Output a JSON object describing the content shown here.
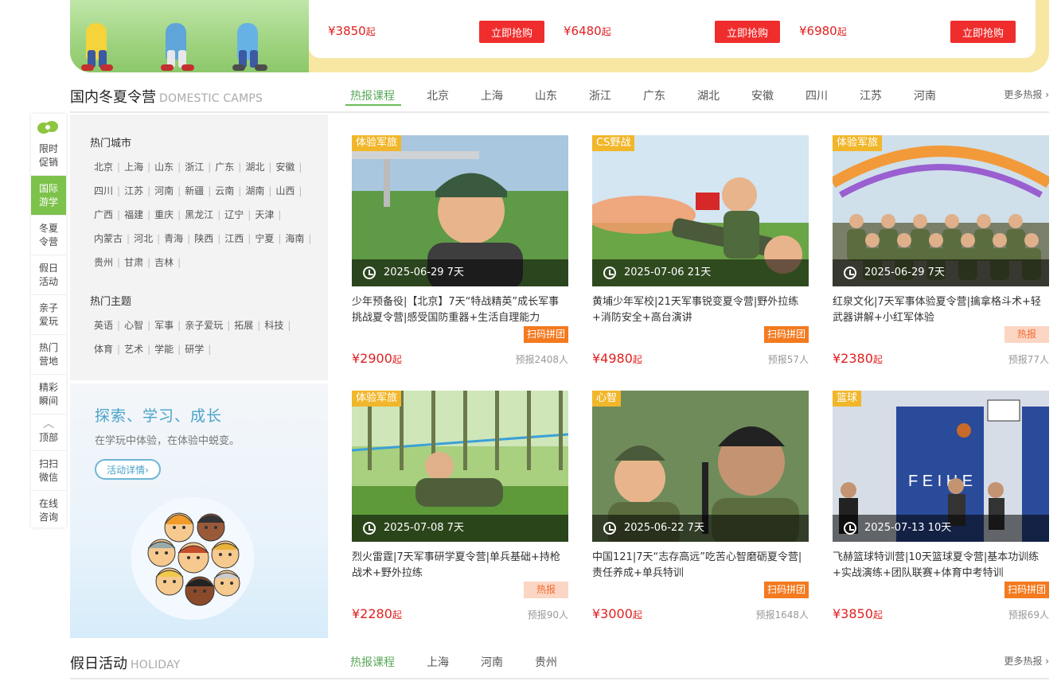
{
  "banner": {
    "deals": [
      {
        "price": "¥3850",
        "suffix": "起",
        "button": "立即抢购"
      },
      {
        "price": "¥6480",
        "suffix": "起",
        "button": "立即抢购"
      },
      {
        "price": "¥6980",
        "suffix": "起",
        "button": "立即抢购"
      }
    ]
  },
  "sidenav": {
    "items": [
      "限时促销",
      "国际游学",
      "冬夏令营",
      "假日活动",
      "亲子爱玩",
      "热门营地",
      "精彩瞬间"
    ],
    "active_index": 1,
    "top_label": "顶部",
    "bottom_items": [
      "扫扫微信",
      "在线咨询"
    ]
  },
  "camps": {
    "title": "国内冬夏令营",
    "title_en": "DOMESTIC CAMPS",
    "tabs": [
      "热报课程",
      "北京",
      "上海",
      "山东",
      "浙江",
      "广东",
      "湖北",
      "安徽",
      "四川",
      "江苏",
      "河南"
    ],
    "more": "更多热报"
  },
  "hot_panel": {
    "cities_title": "热门城市",
    "city_rows": [
      [
        "北京",
        "上海",
        "山东",
        "浙江",
        "广东",
        "湖北",
        "安徽"
      ],
      [
        "四川",
        "江苏",
        "河南",
        "新疆",
        "云南",
        "湖南",
        "山西"
      ],
      [
        "广西",
        "福建",
        "重庆",
        "黑龙江",
        "辽宁",
        "天津"
      ],
      [
        "内蒙古",
        "河北",
        "青海",
        "陕西",
        "江西",
        "宁夏",
        "海南"
      ],
      [
        "贵州",
        "甘肃",
        "吉林"
      ]
    ],
    "themes_title": "热门主题",
    "theme_rows": [
      [
        "英语",
        "心智",
        "军事",
        "亲子爱玩",
        "拓展",
        "科技"
      ],
      [
        "体育",
        "艺术",
        "学能",
        "研学"
      ]
    ]
  },
  "explore": {
    "title": "探索、学习、成长",
    "subtitle": "在学玩中体验，在体验中蜕变。",
    "button": "活动详情›"
  },
  "cards": [
    {
      "category": "体验军旅",
      "date": "2025-06-29 7天",
      "title": "少年预备役|【北京】7天“特战精英”成长军事挑战夏令营|感受国防重器+生活自理能力",
      "tag": "扫码拼团",
      "tag_type": "scan",
      "price": "¥2900",
      "suffix": "起",
      "sold": "预报2408人",
      "scene": "soldier-boy"
    },
    {
      "category": "CS野战",
      "date": "2025-07-06 21天",
      "title": "黄埔少年军校|21天军事锐变夏令营|野外拉练+消防安全+高台演讲",
      "tag": "扫码拼团",
      "tag_type": "scan",
      "price": "¥4980",
      "suffix": "起",
      "sold": "预报57人",
      "scene": "cannon"
    },
    {
      "category": "体验军旅",
      "date": "2025-06-29 7天",
      "title": "红泉文化|7天军事体验夏令营|擒拿格斗术+轻武器讲解+小红军体验",
      "tag": "热报",
      "tag_type": "hot",
      "price": "¥2380",
      "suffix": "起",
      "sold": "预报77人",
      "scene": "parade"
    },
    {
      "category": "体验军旅",
      "date": "2025-07-08 7天",
      "title": "烈火雷霆|7天军事研学夏令营|单兵基础+持枪战术+野外拉练",
      "tag": "热报",
      "tag_type": "hot",
      "price": "¥2280",
      "suffix": "起",
      "sold": "预报90人",
      "scene": "crawl"
    },
    {
      "category": "心智",
      "date": "2025-06-22 7天",
      "title": "中国121|7天“志存高远”吃苦心智磨砺夏令营|责任养成+单兵特训",
      "tag": "扫码拼团",
      "tag_type": "scan",
      "price": "¥3000",
      "suffix": "起",
      "sold": "预报1648人",
      "scene": "two-boys"
    },
    {
      "category": "篮球",
      "date": "2025-07-13 10天",
      "title": "飞赫篮球特训营|10天篮球夏令营|基本功训练+实战演练+团队联赛+体育中考特训",
      "tag": "扫码拼团",
      "tag_type": "scan",
      "price": "¥3850",
      "suffix": "起",
      "sold": "预报69人",
      "scene": "basketball"
    }
  ],
  "holiday": {
    "title": "假日活动",
    "title_en": "HOLIDAY",
    "tabs": [
      "热报课程",
      "上海",
      "河南",
      "贵州"
    ],
    "more": "更多热报"
  },
  "colors": {
    "price_red": "#e02020",
    "buy_button": "#f02d2d",
    "active_green": "#5aa859",
    "side_active": "#7dc24b",
    "category_yellow": "#f1b62a",
    "scan_orange": "#f47a1f"
  }
}
